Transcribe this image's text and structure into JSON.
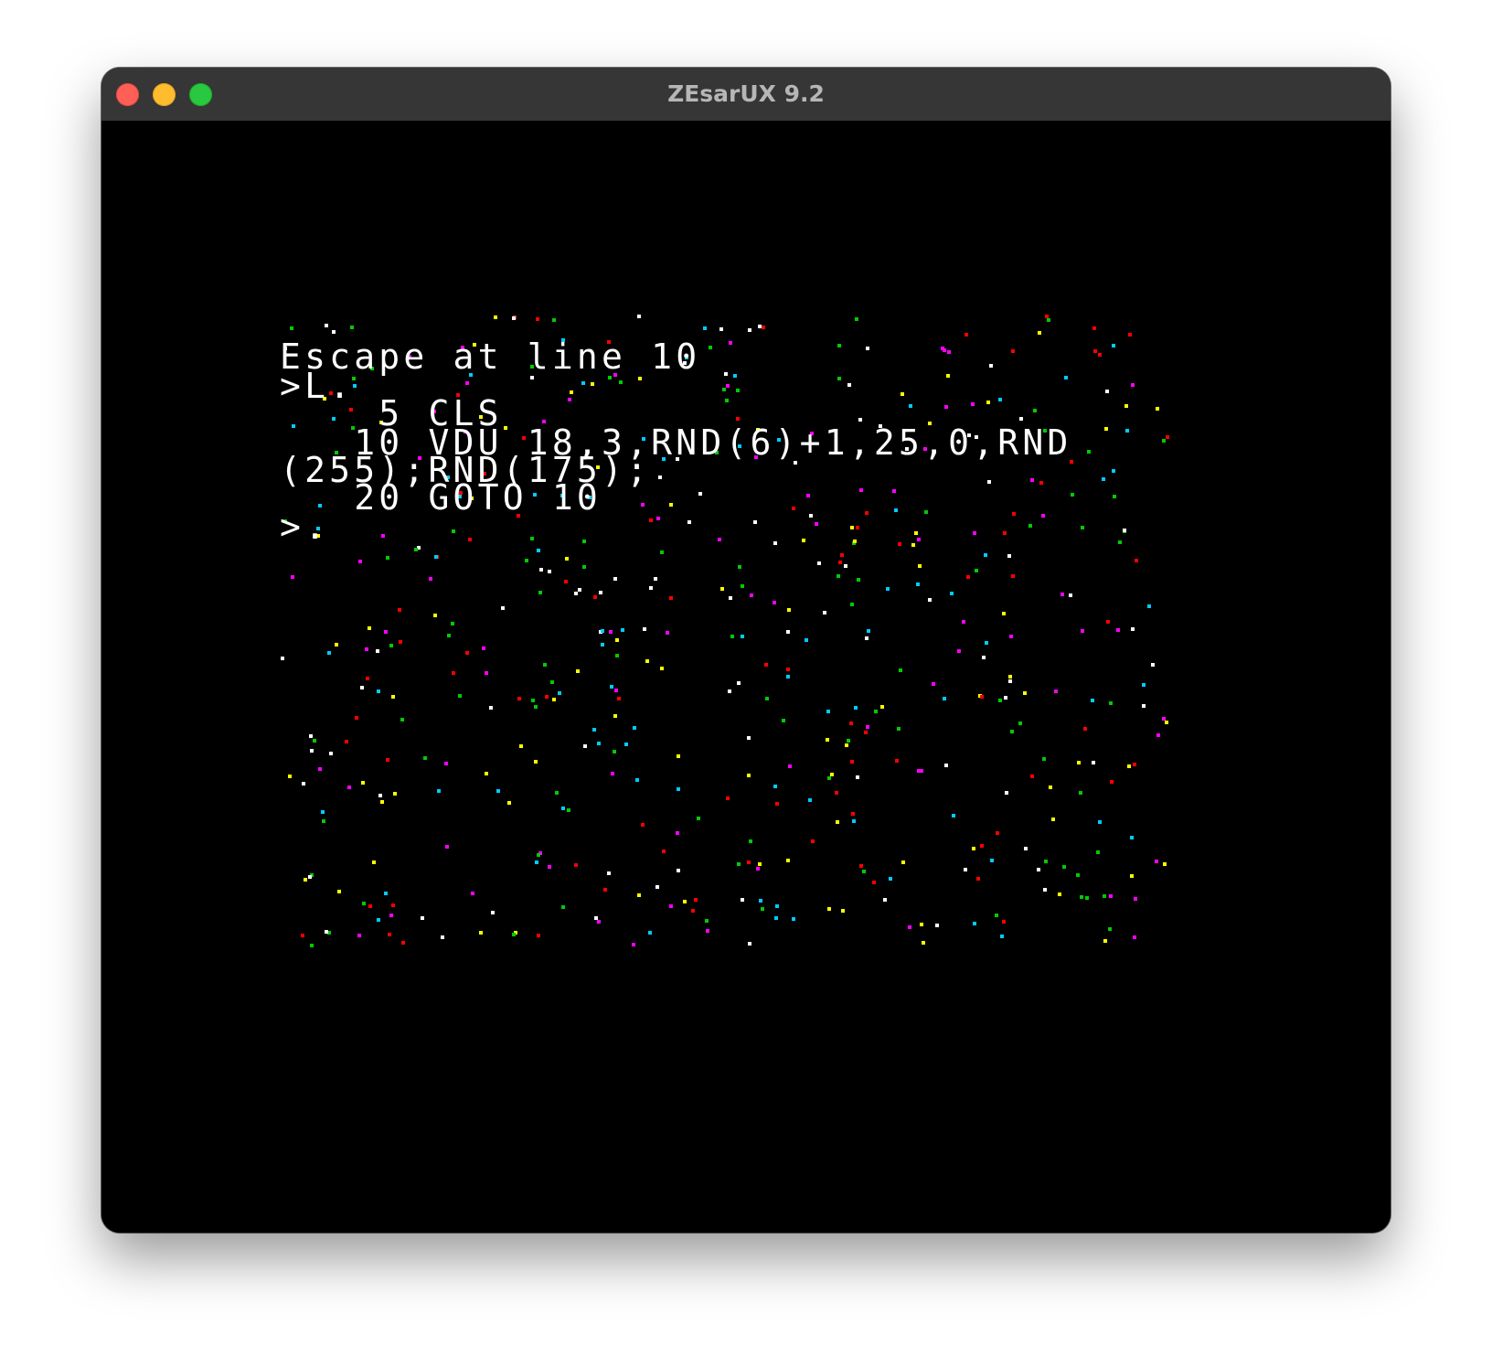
{
  "window": {
    "title": "ZEsarUX 9.2"
  },
  "terminal": {
    "lines": [
      "Escape at line 10",
      ">L.",
      "    5 CLS",
      "   10 VDU 18,3,RND(6)+1,25,0,RND",
      "(255);RND(175);",
      "   20 GOTO 10",
      ">."
    ],
    "text_color": "#ffffff"
  },
  "colors": {
    "screen_background": "#000000",
    "pixel_palette": [
      "#ff0000",
      "#00cc00",
      "#ffff00",
      "#ff00ff",
      "#00ccff",
      "#ffffff"
    ]
  },
  "icons": {
    "close": "close-icon",
    "minimize": "minimize-icon",
    "zoom": "zoom-icon",
    "logo": "zesarux-logo-icon"
  }
}
